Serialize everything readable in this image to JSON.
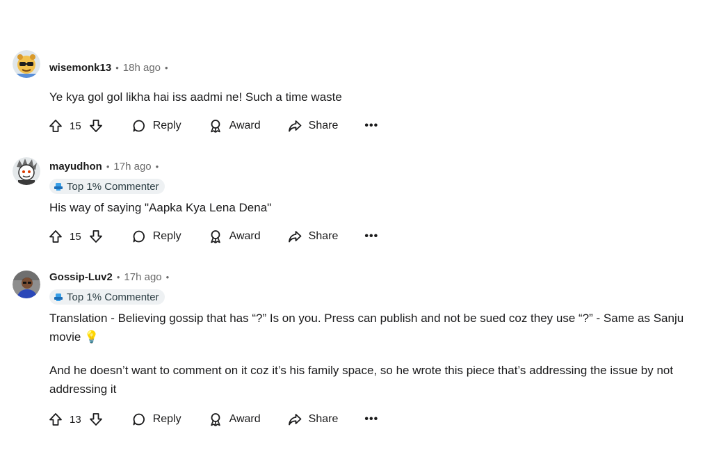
{
  "comments": [
    {
      "username": "wisemonk13",
      "time": "18h ago",
      "flair": "",
      "body": [
        "Ye kya gol gol likha hai iss aadmi ne! Such a time waste"
      ],
      "score": "15"
    },
    {
      "username": "mayudhon",
      "time": "17h ago",
      "flair": "Top 1% Commenter",
      "body": [
        "His way of saying \"Aapka Kya Lena Dena\""
      ],
      "score": "15"
    },
    {
      "username": "Gossip-Luv2",
      "time": "17h ago",
      "flair": "Top 1% Commenter",
      "body": [
        "Translation - Believing gossip that has “?” Is on you. Press can publish and not be sued coz they use “?” - Same as Sanju movie 💡",
        "And he doesn’t want to comment on it coz it’s his family space, so he wrote this piece that’s addressing the issue by not addressing it"
      ],
      "score": "13"
    }
  ],
  "actions": {
    "reply": "Reply",
    "award": "Award",
    "share": "Share",
    "more": "•••"
  },
  "icons": {
    "upvote": "upvote-arrow-icon",
    "downvote": "downvote-arrow-icon",
    "reply": "speech-bubble-icon",
    "award": "award-ribbon-icon",
    "share": "share-arrow-icon",
    "flair": "trophy-icon"
  },
  "colors": {
    "text": "#1a1a1b",
    "meta": "#6a6a6a",
    "flair_bg": "#eef1f3",
    "flair_icon": "#3aa0e8"
  }
}
